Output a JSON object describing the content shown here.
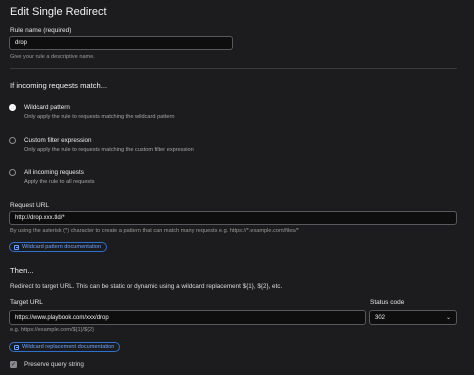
{
  "page": {
    "title": "Edit Single Redirect"
  },
  "rule_name": {
    "label": "Rule name (required)",
    "value": "drop",
    "hint": "Give your rule a descriptive name."
  },
  "match": {
    "heading": "If incoming requests match...",
    "options": [
      {
        "label": "Wildcard pattern",
        "desc": "Only apply the rule to requests matching the wildcard pattern",
        "selected": true
      },
      {
        "label": "Custom filter expression",
        "desc": "Only apply the rule to requests matching the custom filter expression",
        "selected": false
      },
      {
        "label": "All incoming requests",
        "desc": "Apply the rule to all requests",
        "selected": false
      }
    ]
  },
  "request_url": {
    "label": "Request URL",
    "value": "http://drop.xxx.tld/*",
    "hint": "By using the asterisk (*) character to create a pattern that can match many requests e.g. https://*.example.com/files/*",
    "doc_link": "Wildcard pattern documentation"
  },
  "then": {
    "heading": "Then...",
    "desc": "Redirect to target URL. This can be static or dynamic using a wildcard replacement ${1}, ${2}, etc."
  },
  "target_url": {
    "label": "Target URL",
    "value": "https://www.playbook.com/xxx/drop",
    "hint": "e.g. https://example.com/${1}/${2}",
    "doc_link": "Wildcard replacement documentation"
  },
  "status_code": {
    "label": "Status code",
    "value": "302"
  },
  "preserve_query": {
    "label": "Preserve query string",
    "checked": true
  },
  "colors": {
    "background": "#1c1c1e",
    "input_bg": "#0e0e0f",
    "link": "#6aa3ff",
    "link_border": "#2f6fce"
  }
}
